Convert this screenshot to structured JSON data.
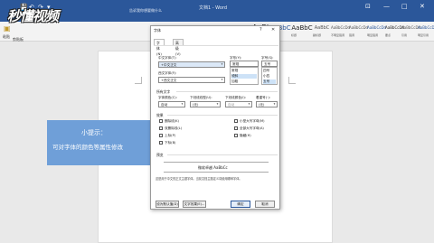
{
  "titlebar": {
    "title": "文档1 - Word",
    "search_placeholder": "告诉我你想要做什么",
    "quick_access": [
      "💾",
      "↶",
      "↷",
      "▾"
    ],
    "window_buttons": [
      "⊡",
      "—",
      "□",
      "✕"
    ]
  },
  "logo": {
    "text": "秒懂视频"
  },
  "ribbon": {
    "paste_label": "粘贴",
    "clipboard_label": "剪贴板",
    "styles": [
      {
        "sample": "AaBbCcDd",
        "label": "正文"
      },
      {
        "sample": "AaBbCcDd",
        "label": "无间隔"
      },
      {
        "sample": "AaBl",
        "label": "标题 1"
      },
      {
        "sample": "AaBbC",
        "label": "标题 2"
      },
      {
        "sample": "AaBbC",
        "label": "标题"
      },
      {
        "sample": "AaBbC",
        "label": "副标题"
      },
      {
        "sample": "AaBbCcDd",
        "label": "不明显强调"
      },
      {
        "sample": "AaBbCcDd",
        "label": "强调"
      },
      {
        "sample": "AaBbCcDd",
        "label": "明显强调"
      },
      {
        "sample": "AaBbCcDd",
        "label": "要点"
      },
      {
        "sample": "AaBbCcDd",
        "label": "引用"
      },
      {
        "sample": "AaBbCcD",
        "label": "明显引用"
      }
    ]
  },
  "tip": {
    "title": "小提示：",
    "text": "可对字体的颜色等属性修改"
  },
  "dialog": {
    "title": "字体",
    "help": "?",
    "close": "✕",
    "tabs": [
      "字体(N)",
      "高级(V)"
    ],
    "chinese_font_label": "中文字体(T):",
    "chinese_font_value": "+中文正文",
    "western_font_label": "西文字体(F):",
    "western_font_value": "+西文正文",
    "style_label": "字形(Y):",
    "style_value": "常规",
    "style_options": [
      "常规",
      "倾斜",
      "加粗"
    ],
    "size_label": "字号(S):",
    "size_value": "五号",
    "size_options": [
      "四号",
      "小四",
      "五号"
    ],
    "all_text_label": "所有文字",
    "font_color_label": "字体颜色(C):",
    "font_color_value": "自动",
    "underline_label": "下划线线型(U):",
    "underline_value": "(无)",
    "underline_color_label": "下划线颜色(I):",
    "underline_color_value": "自动",
    "emphasis_label": "着重号(·):",
    "emphasis_value": "(无)",
    "effects_label": "效果",
    "effects_left": [
      "删除线(K)",
      "双删除线(L)",
      "上标(P)",
      "下标(B)"
    ],
    "effects_right": [
      "小型大写字母(M)",
      "全部大写字母(A)",
      "隐藏(H)"
    ],
    "preview_label": "预览",
    "preview_text": "微软卓越 AaBbCc",
    "note": "这是用于中文的正文主题字体。当前文档主题定义将使用哪种字体。",
    "buttons": {
      "default": "设为默认值(D)",
      "effects": "文字效果(E)...",
      "ok": "确定",
      "cancel": "取消"
    }
  }
}
